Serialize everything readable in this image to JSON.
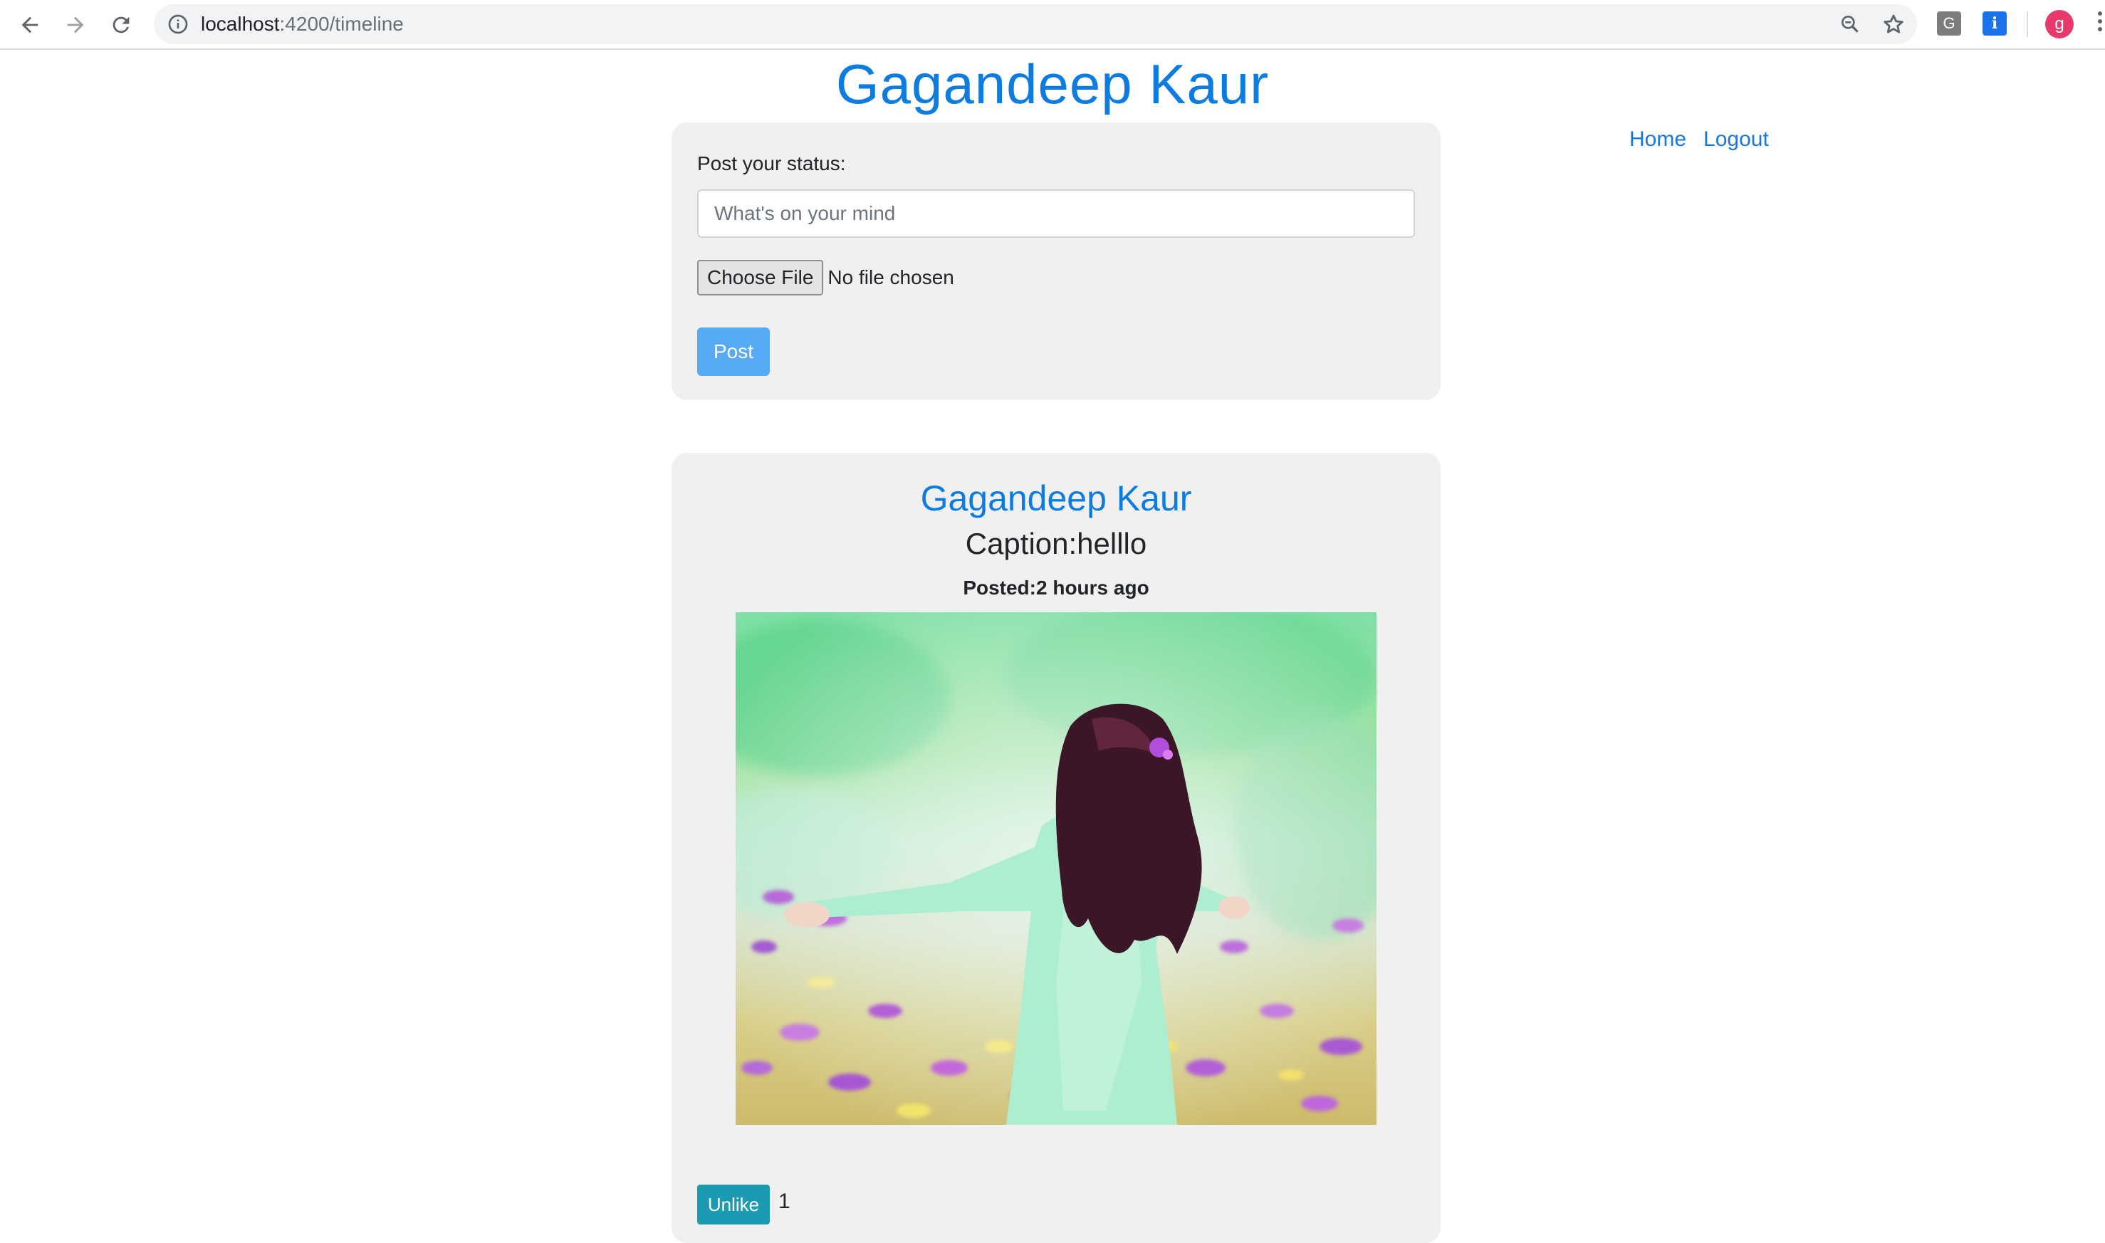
{
  "browser": {
    "url_host": "localhost",
    "url_path": ":4200/timeline",
    "extensions": {
      "g_label": "G",
      "i_label": "i"
    },
    "profile_initial": "g"
  },
  "page": {
    "title": "Gagandeep Kaur"
  },
  "topnav": {
    "home_label": "Home",
    "logout_label": "Logout"
  },
  "status_form": {
    "label": "Post your status:",
    "placeholder": "What's on your mind",
    "value": "",
    "choose_file_label": "Choose File",
    "file_status": "No file chosen",
    "post_label": "Post"
  },
  "post": {
    "author": "Gagandeep Kaur",
    "caption": "Caption:helllo",
    "posted": "Posted:2 hours ago",
    "unlike_label": "Unlike",
    "like_count": "1"
  },
  "colors": {
    "brand_blue": "#0d7ce0",
    "link_blue": "#1877e0",
    "post_button": "#57aaf6",
    "unlike_button": "#1b9bb2",
    "card_bg": "#f0f0f0"
  },
  "icons": [
    "back-arrow-icon",
    "forward-arrow-icon",
    "reload-icon",
    "info-icon",
    "zoom-icon",
    "star-icon",
    "menu-kebab-icon"
  ]
}
